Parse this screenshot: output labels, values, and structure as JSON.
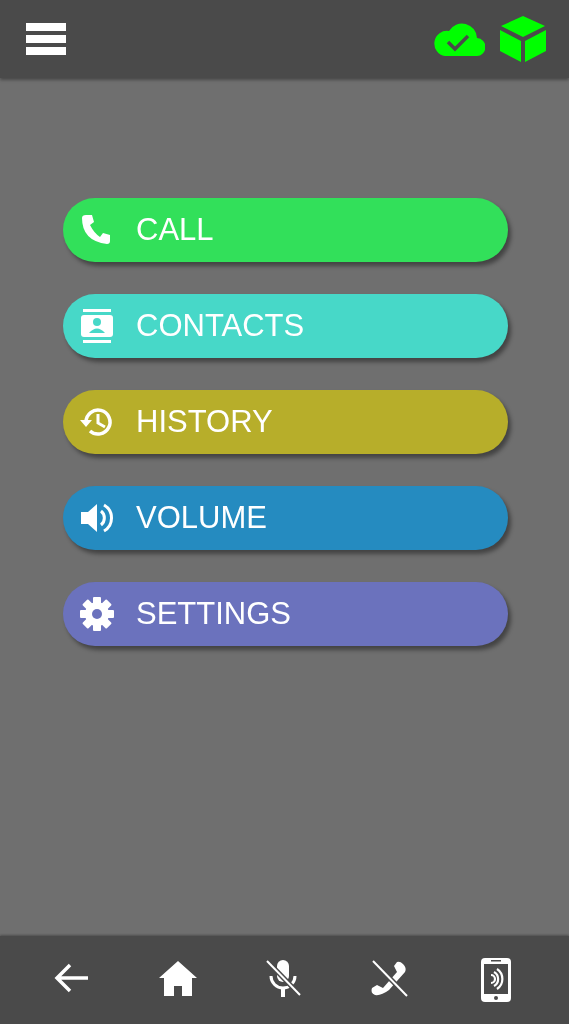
{
  "menu": [
    {
      "kind": "call",
      "label": "CALL",
      "color": "#32e05a"
    },
    {
      "kind": "contacts",
      "label": "CONTACTS",
      "color": "#47d8c8"
    },
    {
      "kind": "history",
      "label": "HISTORY",
      "color": "#b7ae2a"
    },
    {
      "kind": "volume",
      "label": "VOLUME",
      "color": "#258bc0"
    },
    {
      "kind": "settings",
      "label": "SETTINGS",
      "color": "#6b72bd"
    }
  ],
  "bottom_bar": [
    {
      "kind": "back"
    },
    {
      "kind": "home"
    },
    {
      "kind": "mic-off"
    },
    {
      "kind": "phone-off"
    },
    {
      "kind": "phone-signal"
    }
  ]
}
